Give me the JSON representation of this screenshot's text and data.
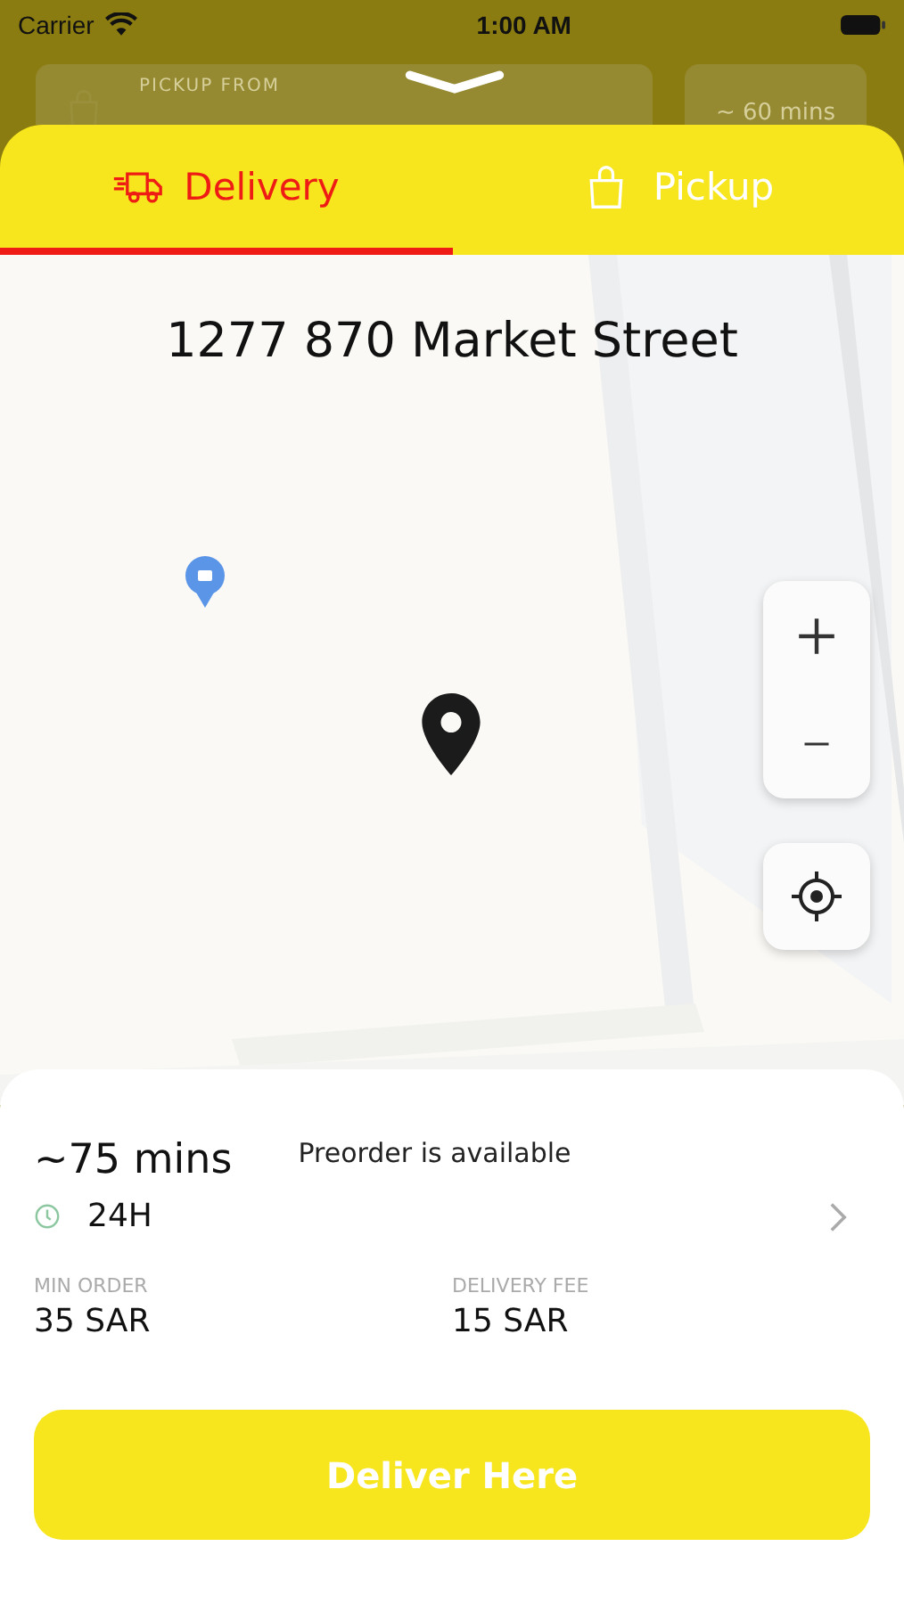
{
  "status_bar": {
    "carrier": "Carrier",
    "time": "1:00 AM"
  },
  "background": {
    "pickup_label": "PICKUP FROM",
    "time_estimate": "~ 60 mins"
  },
  "tabs": [
    {
      "label": "Delivery",
      "kind": "truck",
      "selected": true
    },
    {
      "label": "Pickup",
      "kind": "bag",
      "selected": false
    }
  ],
  "map": {
    "address": "1277 870 Market Street"
  },
  "info": {
    "time": "~75 mins",
    "preorder": "Preorder is available",
    "hours": "24H",
    "min_order_label": "MIN ORDER",
    "min_order": "35 SAR",
    "fee_label": "DELIVERY FEE",
    "fee": "15 SAR"
  },
  "action": {
    "label": "Deliver Here"
  }
}
